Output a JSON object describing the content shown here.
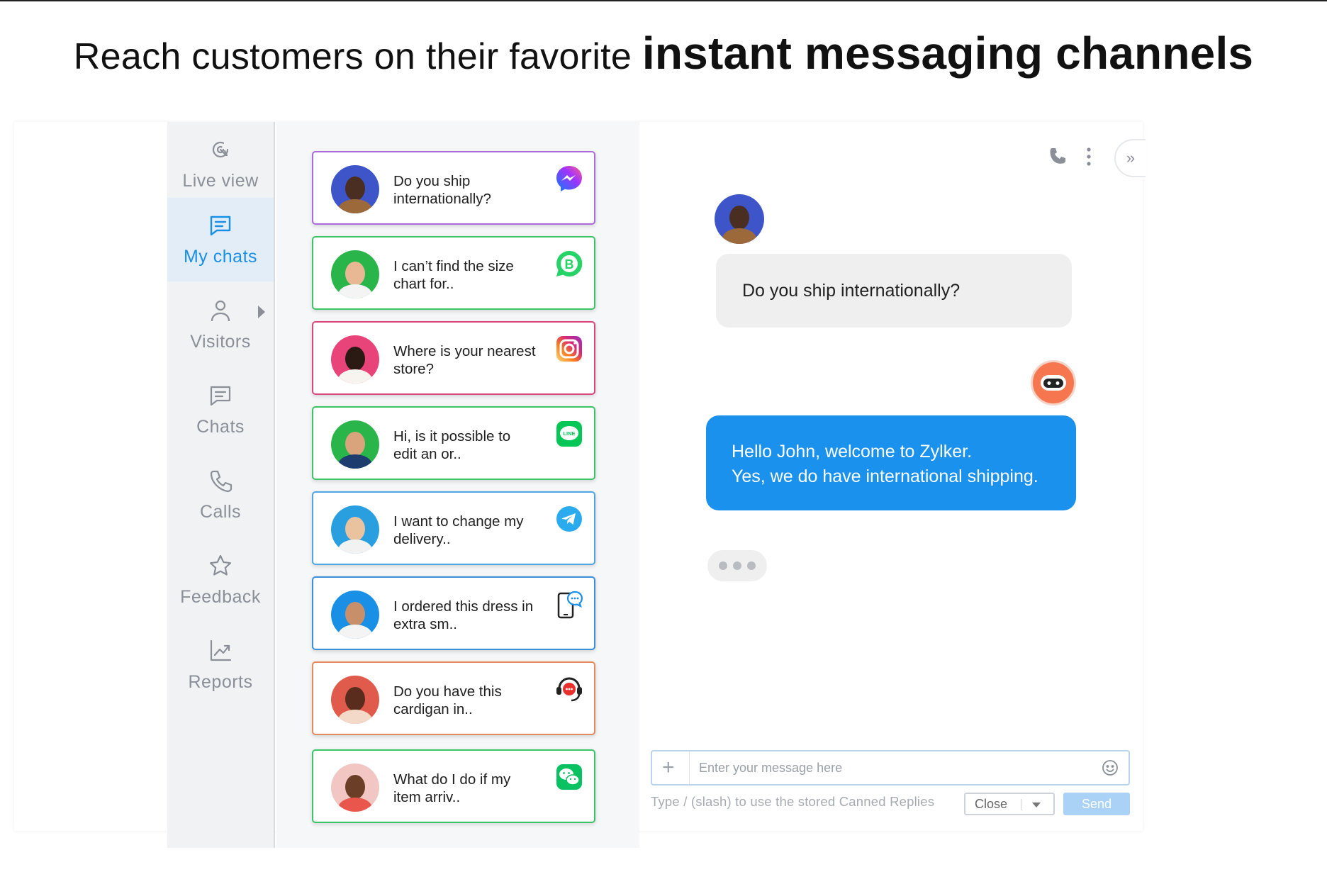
{
  "headline": {
    "light": "Reach customers on their favorite ",
    "bold": "instant messaging channels"
  },
  "nav": {
    "items": [
      {
        "label": "Live view",
        "icon": "live-view-icon",
        "active": false
      },
      {
        "label": "My chats",
        "icon": "chat-bubble-icon",
        "active": true
      },
      {
        "label": "Visitors",
        "icon": "user-icon",
        "active": false
      },
      {
        "label": "Chats",
        "icon": "chat-bubble-icon",
        "active": false
      },
      {
        "label": "Calls",
        "icon": "phone-icon",
        "active": false
      },
      {
        "label": "Feedback",
        "icon": "star-icon",
        "active": false
      },
      {
        "label": "Reports",
        "icon": "chart-icon",
        "active": false
      }
    ]
  },
  "chats": [
    {
      "line1": "Do you ship",
      "line2": "internationally?",
      "channel": "messenger-icon",
      "border": "#a96cd9"
    },
    {
      "line1": "I can’t find the size",
      "line2": "chart for..",
      "channel": "whatsapp-business-icon",
      "border": "#3cc46a"
    },
    {
      "line1": "Where is your nearest",
      "line2": "store?",
      "channel": "instagram-icon",
      "border": "#d9477a"
    },
    {
      "line1": "Hi, is it possible to",
      "line2": "edit an or..",
      "channel": "line-icon",
      "border": "#3cc46a"
    },
    {
      "line1": " I want to change my",
      "line2": "delivery..",
      "channel": "telegram-icon",
      "border": "#4fa6e0"
    },
    {
      "line1": "I ordered this dress in",
      "line2": "extra sm..",
      "channel": "mobile-chat-icon",
      "border": "#3a8fd8"
    },
    {
      "line1": "Do you have this",
      "line2": "cardigan in..",
      "channel": "support-headset-icon",
      "border": "#e58a5c"
    },
    {
      "line1": "What do I do if my",
      "line2": "item arriv..",
      "channel": "wechat-icon",
      "border": "#3cc46a"
    }
  ],
  "conversation": {
    "incoming": "Do you ship internationally?",
    "outgoing_line1": "Hello John, welcome to Zylker.",
    "outgoing_line2": "Yes, we do have international shipping."
  },
  "composer": {
    "placeholder": "Enter your message here",
    "hint": "Type / (slash) to use the stored Canned Replies",
    "close_label": "Close",
    "send_label": "Send"
  },
  "colors": {
    "accent": "#1a91ed",
    "active_nav_bg": "#e2edf8"
  }
}
